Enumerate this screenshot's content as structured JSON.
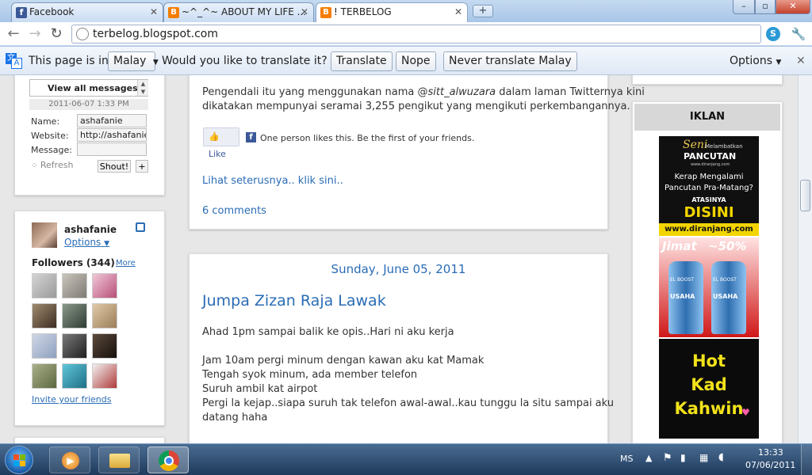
{
  "colors": {
    "accent_blue": "#2a6cb5",
    "blogger_orange": "#f57d00",
    "facebook_blue": "#3b5998",
    "ad_gold": "#f2d500"
  },
  "tabs": [
    {
      "title": "Facebook",
      "favicon": "facebook-icon"
    },
    {
      "title": "~^_^~ ABOUT MY LIFE ...",
      "favicon": "blogger-icon"
    },
    {
      "title": "! TERBELOG",
      "favicon": "blogger-icon"
    }
  ],
  "window_buttons": {
    "minimize": "–",
    "maximize": "▫",
    "close": "✕"
  },
  "toolbar": {
    "url": "terbelog.blogspot.com",
    "back": "←",
    "forward": "→",
    "reload": "↻",
    "star": "☆",
    "wrench": "🔧"
  },
  "translate_bar": {
    "message": "This page is in",
    "language": "Malay",
    "question": "Would you like to translate it?",
    "translate": "Translate",
    "nope": "Nope",
    "never": "Never translate Malay",
    "options": "Options"
  },
  "shoutbox": {
    "view_all": "View all messages",
    "timestamp": "2011-06-07 1:33 PM",
    "name_label": "Name:",
    "name_value": "ashafanie",
    "website_label": "Website:",
    "website_value": "http://ashafanie-n",
    "message_label": "Message:",
    "message_value": "",
    "refresh": "Refresh",
    "shout": "Shout!",
    "plus": "+"
  },
  "followers": {
    "username": "ashafanie",
    "options": "Options",
    "title": "Followers (344)",
    "more": "More",
    "invite": "Invite your friends"
  },
  "post1": {
    "line1_pre": "Pengendali itu yang menggunakan nama @",
    "line1_handle": "sitt_alwuzara",
    "line1_post": " dalam laman Twitternya kini",
    "line2": "dikatakan mempunyai seramai 3,255 pengikut yang mengikuti perkembangannya.",
    "like": "Like",
    "like_text": "One person likes this. Be the first of your friends.",
    "read_more": "Lihat seterusnya.. klik sini..",
    "comments": "6 comments"
  },
  "post2": {
    "date": "Sunday, June 05, 2011",
    "title": "Jumpa Zizan Raja Lawak",
    "lines": [
      "Ahad 1pm sampai balik ke opis..Hari ni aku kerja",
      "",
      "Jam 10am pergi minum dengan kawan aku kat Mamak",
      "Tengah syok minum, ada member  telefon",
      "Suruh ambil kat airpot",
      "Pergi la kejap..siapa suruh tak telefon awal-awal..kau tunggu la situ sampai aku",
      "datang haha"
    ]
  },
  "ads": {
    "header": "IKLAN",
    "ad1": {
      "seni": "Seni",
      "melambat": "Melambatkan",
      "pancutan": "PANCUTAN",
      "site_small": "www.diranjang.com",
      "q1": "Kerap Mengalami",
      "q2": "Pancutan Pra-Matang?",
      "atasinya": "ATASINYA",
      "disini": "DISINI",
      "url": "www.diranjang.com"
    },
    "ad2": {
      "jimat": "Jimat",
      "pct": "~50%",
      "bottle1": "USAHA",
      "bottle2": "USAHA",
      "brand": "EL BOOST"
    },
    "ad3": {
      "l1": "Hot",
      "l2": "Kad",
      "l3": "Kahwin"
    }
  },
  "taskbar": {
    "lang": "MS",
    "time": "13:33",
    "date": "07/06/2011"
  }
}
